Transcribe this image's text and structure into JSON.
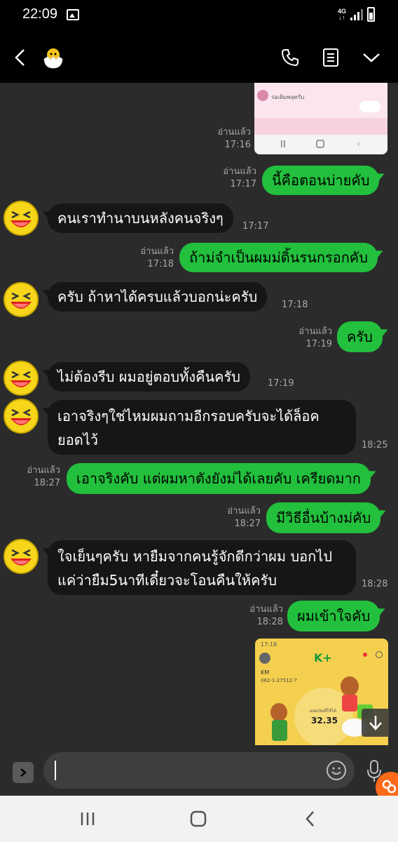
{
  "status_bar": {
    "time": "22:09",
    "network": "4G"
  },
  "chat": {
    "messages": [
      {
        "id": "m1",
        "dir": "out",
        "type": "image",
        "read": "อ่านแล้ว",
        "time": "17:16"
      },
      {
        "id": "m2",
        "dir": "out",
        "text": "นี้คือตอนบ่ายคับ",
        "read": "อ่านแล้ว",
        "time": "17:17"
      },
      {
        "id": "m3",
        "dir": "in",
        "text": "คนเราทำนาบนหลังคนจริงๆ",
        "time": "17:17"
      },
      {
        "id": "m4",
        "dir": "out",
        "text": "ถ้าม่จำเป็นผมม่ดิ้นรนกรอกคับ",
        "read": "อ่านแล้ว",
        "time": "17:18"
      },
      {
        "id": "m5",
        "dir": "in",
        "text": "ครับ ถ้าหาได้ครบแล้วบอกน่ะครับ",
        "time": "17:18"
      },
      {
        "id": "m6",
        "dir": "out",
        "text": "ครับ",
        "read": "อ่านแล้ว",
        "time": "17:19"
      },
      {
        "id": "m7",
        "dir": "in",
        "text": "ไม่ต้องรีบ ผมอยู่ตอบทั้งคืนครับ",
        "time": "17:19"
      },
      {
        "id": "m8",
        "dir": "in",
        "line1": "เอาจริงๆใช่ไหมผมถามอีกรอบครับจะได้ล็อค",
        "line2": "ยอดไว้",
        "time": "18:25"
      },
      {
        "id": "m9",
        "dir": "out",
        "text": "เอาจริงคับ แต่ผมหาตังยังม่ได้เลยคับ เครียดมาก",
        "read": "อ่านแล้ว",
        "time": "18:27"
      },
      {
        "id": "m10",
        "dir": "out",
        "text": "มีวิธีอื่นบ้างม่คับ",
        "read": "อ่านแล้ว",
        "time": "18:27"
      },
      {
        "id": "m11",
        "dir": "in",
        "line1": "ใจเย็นๆครับ หายืมจากคนรู้จักดีกว่าผม บอกไป",
        "line2": "แค่ว่ายืม5นาทีเดี๋ยวจะโอนคืนให้ครับ",
        "time": "18:28"
      },
      {
        "id": "m12",
        "dir": "out",
        "text": "ผมเข้าใจคับ",
        "read": "อ่านแล้ว",
        "time": "18:28"
      },
      {
        "id": "m13",
        "dir": "out",
        "type": "image"
      }
    ]
  },
  "screenshot_top": {
    "label": "รอเติมพลุครับ"
  },
  "screenshot_bottom": {
    "time": "17:18",
    "brand": "K+",
    "name": "KM",
    "account": "062-1-27512-7",
    "amount_label": "ยอดเงินที่ใช้ได้",
    "amount": "32.35"
  },
  "input": {
    "placeholder": ""
  },
  "colors": {
    "outgoing": "#22c03d",
    "incoming": "#161616",
    "background": "#2b2b2b"
  }
}
